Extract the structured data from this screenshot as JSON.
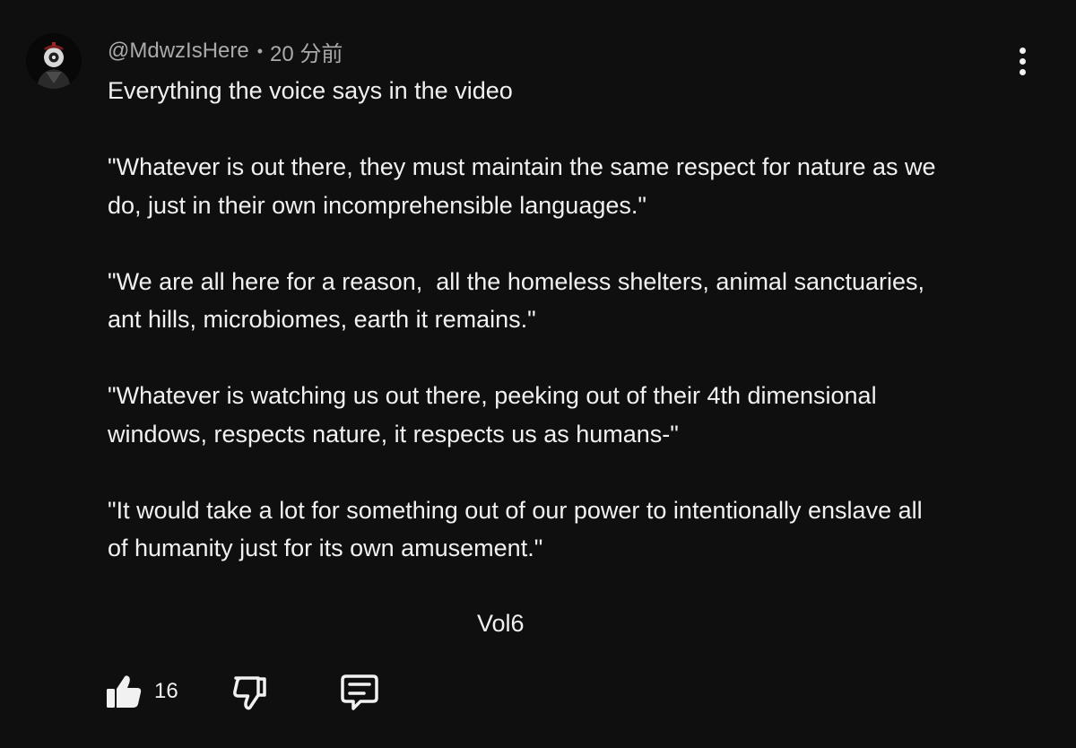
{
  "comment": {
    "author": "@MdwzIsHere",
    "separator": "•",
    "time": "20 分前",
    "lines": [
      "Everything the voice says in the video",
      "",
      "\"Whatever is out there, they must maintain the same respect for nature as we",
      "do, just in their own incomprehensible languages.\"",
      "",
      "\"We are all here for a reason,  all the homeless shelters, animal sanctuaries,",
      "ant hills, microbiomes, earth it remains.\"",
      "",
      "\"Whatever is watching us out there, peeking out of their 4th dimensional",
      "windows, respects nature, it respects us as humans-\"",
      "",
      "\"It would take a lot for something out of our power to intentionally enslave all",
      "of humanity just for its own amusement.\""
    ],
    "signature": "Vol6"
  },
  "actions": {
    "like_count": "16",
    "like_icon": "thumbs-up-icon",
    "dislike_icon": "thumbs-down-icon",
    "reply_icon": "reply-comment-icon",
    "more_icon": "more-vertical-icon"
  },
  "colors": {
    "background": "#0f0f0f",
    "text": "#f1f1f1",
    "meta": "#aaaaaa"
  }
}
